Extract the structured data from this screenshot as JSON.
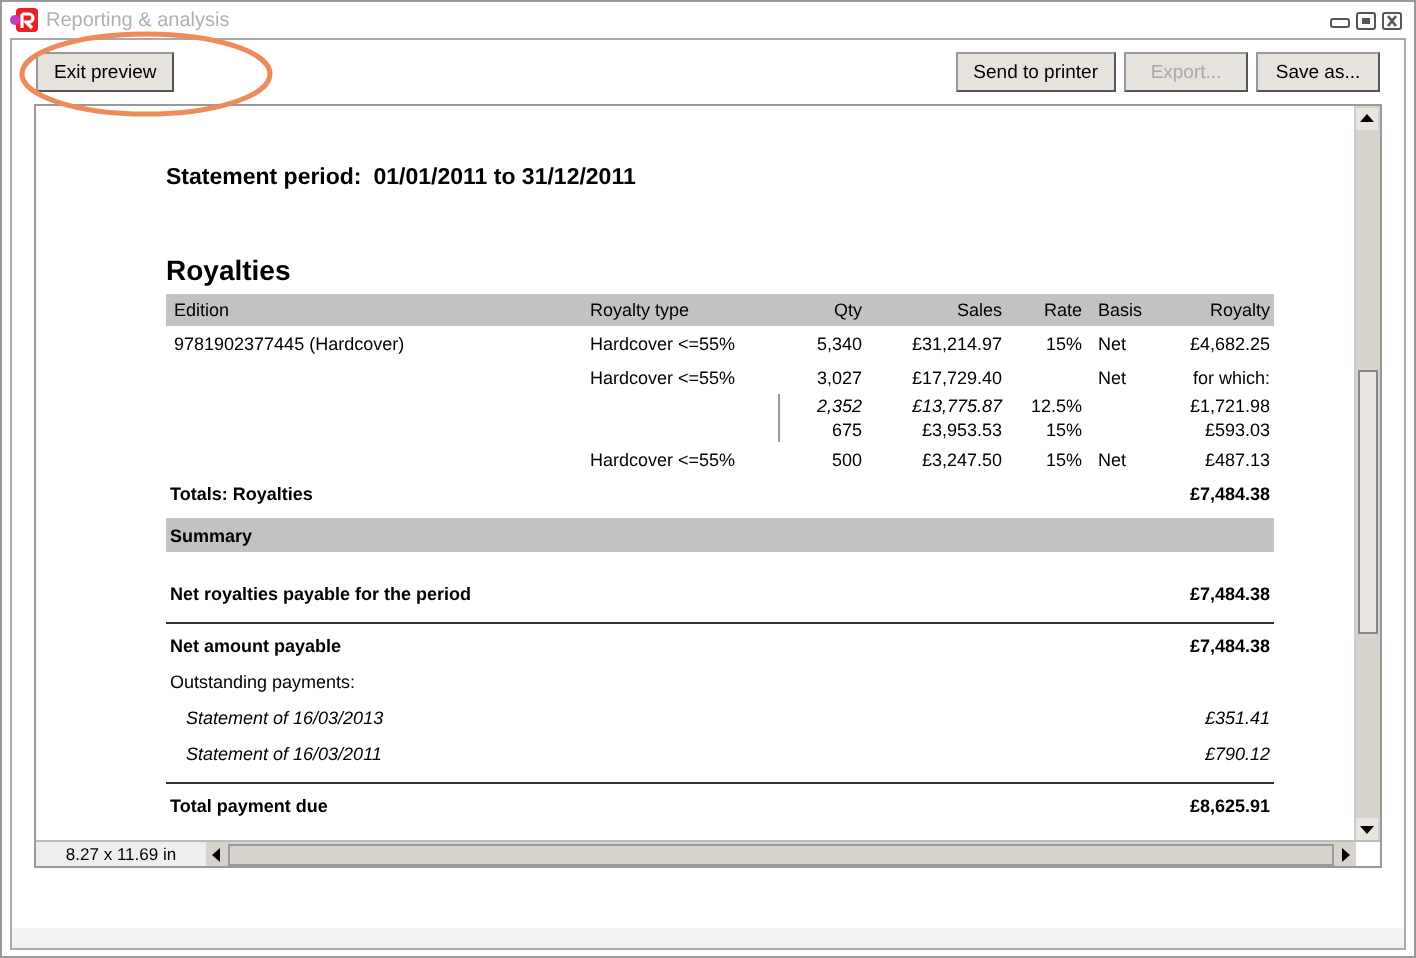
{
  "window": {
    "title": "Reporting & analysis"
  },
  "toolbar": {
    "left_buttons": [
      {
        "label": "Exit preview",
        "disabled": false
      }
    ],
    "right_buttons": [
      {
        "label": "Send to printer",
        "disabled": false
      },
      {
        "label": "Export...",
        "disabled": true
      },
      {
        "label": "Save as...",
        "disabled": false
      }
    ]
  },
  "report": {
    "period_label": "Statement period:",
    "period": "01/01/2011 to 31/12/2011",
    "section_title": "Royalties",
    "columns": [
      "Edition",
      "Royalty type",
      "Qty",
      "Sales",
      "Rate",
      "Basis",
      "Royalty"
    ],
    "rows": [
      {
        "kind": "main",
        "cells": [
          "9781902377445 (Hardcover)",
          "Hardcover <=55%",
          "5,340",
          "£31,214.97",
          "15%",
          "Net",
          "£4,682.25"
        ]
      },
      {
        "kind": "main",
        "cells": [
          "",
          "Hardcover <=55%",
          "3,027",
          "£17,729.40",
          "",
          "Net",
          "for which:"
        ]
      },
      {
        "kind": "sub",
        "cells": [
          "",
          "",
          "2,352",
          "£13,775.87",
          "12.5%",
          "",
          "£1,721.98"
        ]
      },
      {
        "kind": "sub",
        "cells": [
          "",
          "",
          "675",
          "£3,953.53",
          "15%",
          "",
          "£593.03"
        ]
      },
      {
        "kind": "main",
        "cells": [
          "",
          "Hardcover <=55%",
          "500",
          "£3,247.50",
          "15%",
          "Net",
          "£487.13"
        ]
      }
    ],
    "totals": {
      "label": "Totals: Royalties",
      "value": "£7,484.38"
    },
    "summary_title": "Summary",
    "summary": [
      {
        "kind": "bold",
        "label": "Net royalties payable for the period",
        "value": "£7,484.38"
      },
      {
        "kind": "rule"
      },
      {
        "kind": "bold",
        "label": "Net amount payable",
        "value": "£7,484.38"
      },
      {
        "kind": "plain",
        "label": "Outstanding payments:"
      },
      {
        "kind": "italic",
        "label": "Statement of 16/03/2013",
        "value": "£351.41"
      },
      {
        "kind": "italic",
        "label": "Statement of 16/03/2011",
        "value": "£790.12"
      },
      {
        "kind": "rule"
      },
      {
        "kind": "bold",
        "label": "Total payment due",
        "value": "£8,625.91"
      }
    ]
  },
  "status": {
    "page_size": "8.27 x 11.69 in"
  }
}
